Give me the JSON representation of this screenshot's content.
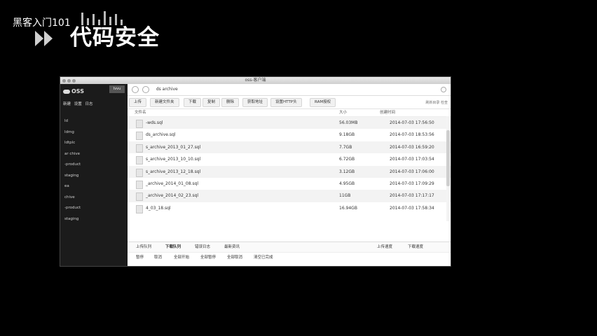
{
  "overlay": {
    "channel": "黑客入门101",
    "title": "代码安全"
  },
  "window": {
    "title": "oss-客户端",
    "sidebar": {
      "logo": "OSS",
      "top_button": "Ivvu",
      "tools": "新建 设置 日志",
      "items": [
        "ld",
        "ldmg",
        "ldtplc",
        "ar chive",
        "-product",
        "staging",
        "ea",
        "chive",
        "-product",
        "staging"
      ]
    },
    "address": "ds archive",
    "toolbar": {
      "buttons": [
        "上传",
        "新建文件夹",
        "下载",
        "复制",
        "删除",
        "获取地址",
        "设置HTTP头",
        "RAM授权"
      ],
      "right": "刷新目录 检查"
    },
    "columns": {
      "name": "文件名",
      "size": "大小",
      "time": "创建时间"
    },
    "files": [
      {
        "name": "-wds.sql",
        "size": "56.03MB",
        "time": "2014-07-03 17:56:50"
      },
      {
        "name": "ds_archive.sql",
        "size": "9.18GB",
        "time": "2014-07-03 18:53:56"
      },
      {
        "name": "s_archive_2013_01_27.sql",
        "size": "7.7GB",
        "time": "2014-07-03 16:59:20"
      },
      {
        "name": "s_archive_2013_10_10.sql",
        "size": "6.72GB",
        "time": "2014-07-03 17:03:54"
      },
      {
        "name": "s_archive_2013_12_18.sql",
        "size": "3.12GB",
        "time": "2014-07-03 17:06:00"
      },
      {
        "name": "_archive_2014_01_08.sql",
        "size": "4.95GB",
        "time": "2014-07-03 17:09:29"
      },
      {
        "name": "_archive_2014_02_23.sql",
        "size": "11GB",
        "time": "2014-07-03 17:17:17"
      },
      {
        "name": "4_03_18.sql",
        "size": "16.94GB",
        "time": "2014-07-03 17:58:34"
      }
    ],
    "queue": {
      "tabs": [
        "上传队列",
        "下载队列",
        "错误日志",
        "最新资讯"
      ],
      "filters": [
        "上传速度",
        "下载速度"
      ],
      "actions": [
        "暂停",
        "取消",
        "全部开始",
        "全部暂停",
        "全部取消",
        "清空已完成"
      ]
    }
  }
}
